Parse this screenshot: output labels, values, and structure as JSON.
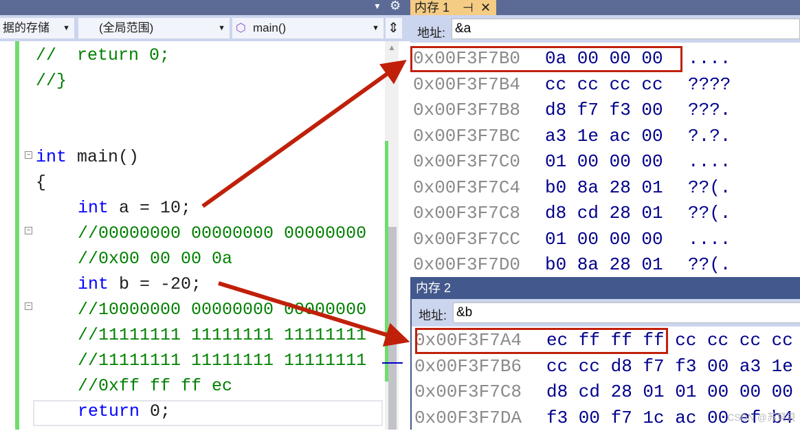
{
  "toolbar": {
    "dropdown_file": "据的存储",
    "dropdown_scope": "(全局范围)",
    "dropdown_func": "main()",
    "icons": [
      "chevron-down-icon",
      "gear-icon",
      "cube-icon",
      "split-icon"
    ]
  },
  "code_lines": [
    {
      "text": "//  return 0;",
      "cls": "cm",
      "indent": 0
    },
    {
      "text": "//}",
      "cls": "cm",
      "indent": 0
    },
    {
      "text": "",
      "cls": "tx",
      "indent": 0
    },
    {
      "text": "",
      "cls": "tx",
      "indent": 0
    },
    {
      "kw": "int",
      "text": " main()",
      "cls": "tx",
      "indent": 0
    },
    {
      "text": "{",
      "cls": "tx",
      "indent": 0
    },
    {
      "kw": "int",
      "text": " a = 10;",
      "cls": "tx",
      "indent": 1
    },
    {
      "text": "//00000000 00000000 00000000",
      "cls": "cm",
      "indent": 1
    },
    {
      "text": "//0x00 00 00 0a",
      "cls": "cm",
      "indent": 1
    },
    {
      "kw": "int",
      "text": " b = -20;",
      "cls": "tx",
      "indent": 1
    },
    {
      "text": "//10000000 00000000 00000000",
      "cls": "cm",
      "indent": 1
    },
    {
      "text": "//11111111 11111111 11111111",
      "cls": "cm",
      "indent": 1
    },
    {
      "text": "//11111111 11111111 11111111",
      "cls": "cm",
      "indent": 1
    },
    {
      "text": "//0xff ff ff ec",
      "cls": "cm",
      "indent": 1
    },
    {
      "kw": "return",
      "text": " 0;",
      "cls": "tx",
      "indent": 1
    }
  ],
  "memory1": {
    "title": "内存 1",
    "pin": "⊣",
    "close": "✕",
    "address_label": "地址:",
    "address_value": "&a",
    "rows": [
      {
        "addr": "0x00F3F7B0",
        "bytes": "0a 00 00 00",
        "ascii": "...."
      },
      {
        "addr": "0x00F3F7B4",
        "bytes": "cc cc cc cc",
        "ascii": "????"
      },
      {
        "addr": "0x00F3F7B8",
        "bytes": "d8 f7 f3 00",
        "ascii": "???."
      },
      {
        "addr": "0x00F3F7BC",
        "bytes": "a3 1e ac 00",
        "ascii": "?.?."
      },
      {
        "addr": "0x00F3F7C0",
        "bytes": "01 00 00 00",
        "ascii": "...."
      },
      {
        "addr": "0x00F3F7C4",
        "bytes": "b0 8a 28 01",
        "ascii": "??(."
      },
      {
        "addr": "0x00F3F7C8",
        "bytes": "d8 cd 28 01",
        "ascii": "??(."
      },
      {
        "addr": "0x00F3F7CC",
        "bytes": "01 00 00 00",
        "ascii": "...."
      },
      {
        "addr": "0x00F3F7D0",
        "bytes": "b0 8a 28 01",
        "ascii": "??(."
      }
    ]
  },
  "memory2": {
    "title": "内存 2",
    "address_label": "地址:",
    "address_value": "&b",
    "rows": [
      {
        "addr": "0x00F3F7A4",
        "bytes": "ec ff ff ff cc cc cc cc"
      },
      {
        "addr": "0x00F3F7B6",
        "bytes": "cc cc d8 f7 f3 00 a3 1e"
      },
      {
        "addr": "0x00F3F7C8",
        "bytes": "d8 cd 28 01 01 00 00 00"
      },
      {
        "addr": "0x00F3F7DA",
        "bytes": "f3 00 f7 1c ac 00 ef b4"
      }
    ]
  },
  "watermark": "CSDN @苏貝貝",
  "colors": {
    "arrow": "#c0200a",
    "comment": "#008000",
    "keyword": "#0000ff",
    "address": "#8a8a8a",
    "bytes": "#00008b"
  }
}
